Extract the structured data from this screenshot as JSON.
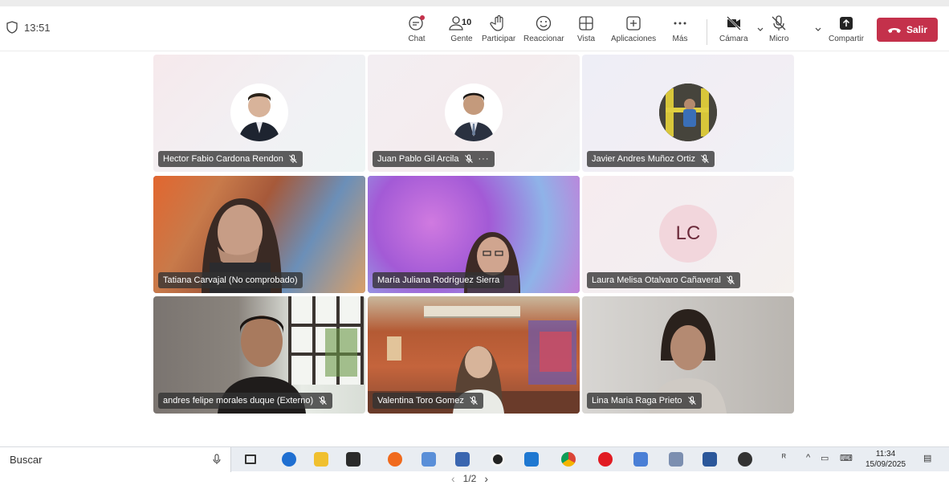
{
  "meeting": {
    "elapsed_time": "13:51",
    "toolbar": {
      "chat_label": "Chat",
      "people_label": "Gente",
      "people_count": "10",
      "raise_label": "Participar",
      "react_label": "Reaccionar",
      "view_label": "Vista",
      "apps_label": "Aplicaciones",
      "more_label": "Más",
      "camera_label": "Cámara",
      "mic_label": "Micro",
      "share_label": "Compartir",
      "leave_label": "Salir"
    },
    "accent_color": "#5b5fc7",
    "leave_color": "#c4314b"
  },
  "participants": [
    {
      "name": "Hector Fabio Cardona Rendon",
      "muted": true
    },
    {
      "name": "Juan Pablo Gil Arcila",
      "muted": true,
      "more": "···"
    },
    {
      "name": "Javier Andres Muñoz Ortiz",
      "muted": true
    },
    {
      "name": "Tatiana Carvajal (No comprobado)",
      "muted": false
    },
    {
      "name": "María Juliana Rodríguez Sierra",
      "muted": false
    },
    {
      "name": "Laura Melisa Otalvaro Cañaveral",
      "muted": true,
      "initials": "LC"
    },
    {
      "name": "andres felipe morales duque (Externo)",
      "muted": true
    },
    {
      "name": "Valentina Toro Gomez",
      "muted": true
    },
    {
      "name": "Lina Maria Raga Prieto",
      "muted": true
    }
  ],
  "pager": {
    "label": "1/2"
  },
  "taskbar": {
    "search_placeholder": "Buscar",
    "time": "11:34",
    "date": "15/09/2025"
  }
}
